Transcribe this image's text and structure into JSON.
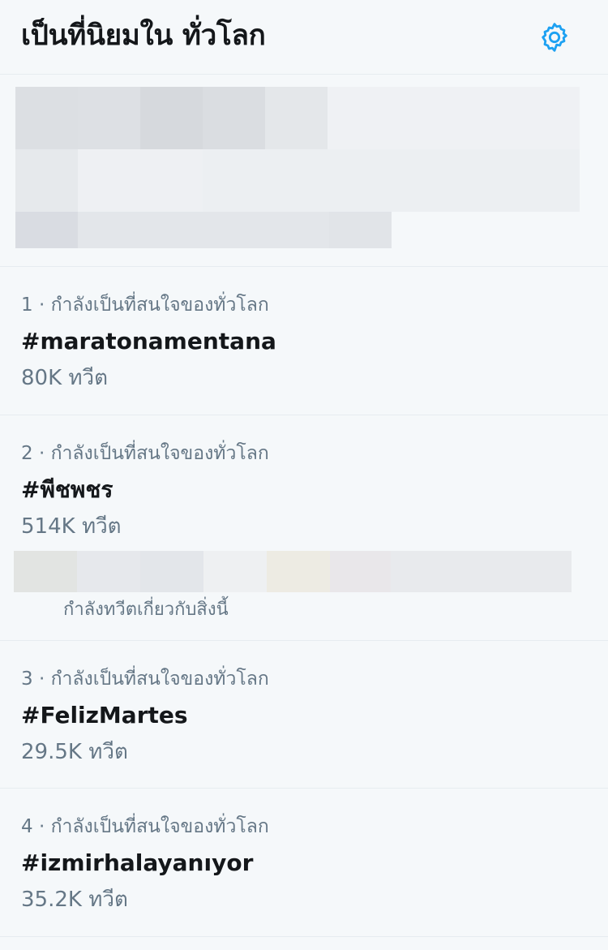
{
  "header": {
    "title": "เป็นที่นิยมใน ทั่วโลก",
    "settings_icon": "gear-icon",
    "accent_color": "#1da1f2"
  },
  "trends": [
    {
      "meta": "1 · กำลังเป็นที่สนใจของทั่วโลก",
      "name": "#maratonamentana",
      "count": "80K ทวีต"
    },
    {
      "meta": "2 · กำลังเป็นที่สนใจของทั่วโลก",
      "name": "#พีชพชร",
      "count": "514K ทวีต",
      "context": "กำลังทวีตเกี่ยวกับสิ่งนี้"
    },
    {
      "meta": "3 · กำลังเป็นที่สนใจของทั่วโลก",
      "name": "#FelizMartes",
      "count": "29.5K ทวีต"
    },
    {
      "meta": "4 · กำลังเป็นที่สนใจของทั่วโลก",
      "name": "#izmirhalayanıyor",
      "count": "35.2K ทวีต"
    }
  ]
}
